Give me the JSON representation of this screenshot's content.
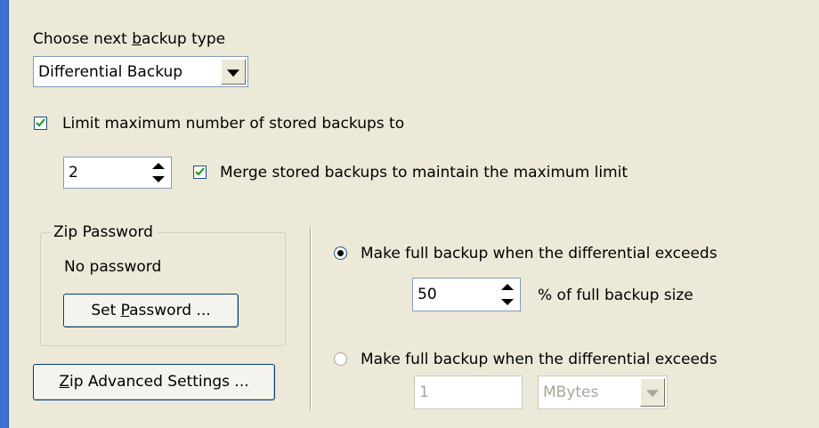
{
  "backup_type": {
    "label_prefix": "Choose next ",
    "label_hotkey": "b",
    "label_suffix": "ackup type",
    "selected": "Differential Backup"
  },
  "limit_backups": {
    "checked": true,
    "label": "Limit maximum number of stored backups to",
    "count": "2",
    "merge_checked": true,
    "merge_label": "Merge stored backups to maintain the maximum limit"
  },
  "zip_password": {
    "group_title": "Zip Password",
    "status": "No password",
    "button_prefix": "Set ",
    "button_hotkey": "P",
    "button_suffix": "assword ..."
  },
  "zip_advanced": {
    "button_hotkey": "Z",
    "button_suffix": "ip Advanced Settings ..."
  },
  "full_backup_percent": {
    "selected": true,
    "label": "Make full backup when the differential exceeds",
    "value": "50",
    "suffix": "% of full backup size"
  },
  "full_backup_size": {
    "selected": false,
    "label": "Make full backup when the differential exceeds",
    "value": "1",
    "unit": "MBytes"
  }
}
